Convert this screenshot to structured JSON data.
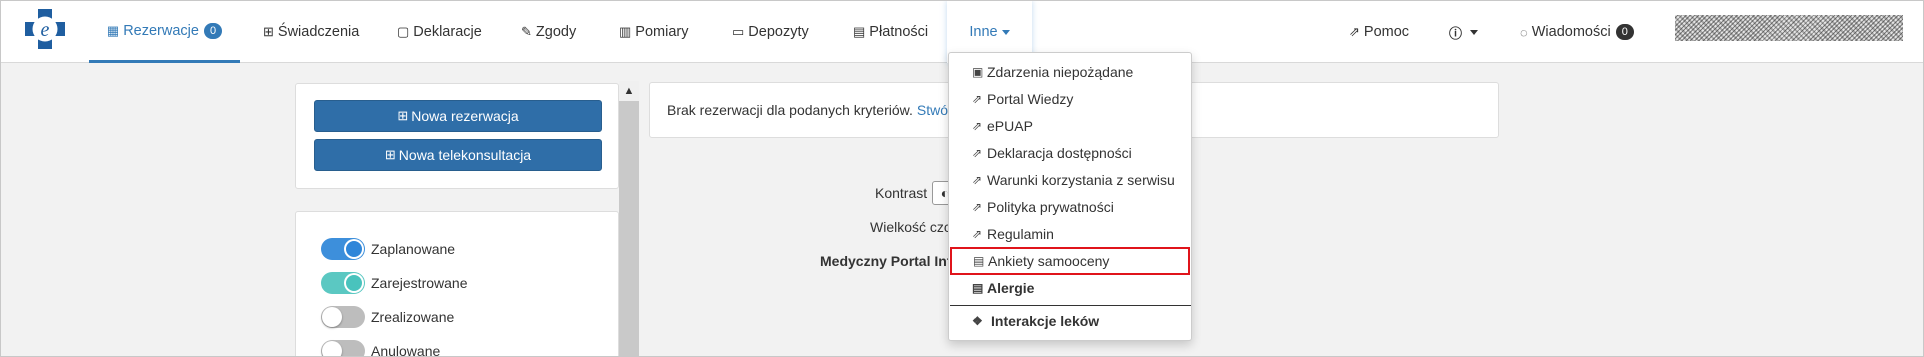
{
  "nav": {
    "items": [
      {
        "label": "Rezerwacje",
        "icon": "calendar-icon",
        "badge": "0"
      },
      {
        "label": "Świadczenia",
        "icon": "medkit-icon"
      },
      {
        "label": "Deklaracje",
        "icon": "file-icon"
      },
      {
        "label": "Zgody",
        "icon": "edit-icon"
      },
      {
        "label": "Pomiary",
        "icon": "bar-chart-icon"
      },
      {
        "label": "Depozyty",
        "icon": "folder-icon"
      },
      {
        "label": "Płatności",
        "icon": "credit-card-icon"
      },
      {
        "label": "Inne"
      }
    ],
    "right": {
      "help_label": "Pomoc",
      "messages_label": "Wiadomości",
      "messages_badge": "0"
    }
  },
  "left_panel": {
    "new_reservation": "Nowa rezerwacja",
    "new_teleconsultation": "Nowa telekonsultacja",
    "filters": [
      {
        "label": "Zaplanowane",
        "on": true,
        "color": "#3d8fdb"
      },
      {
        "label": "Zarejestrowane",
        "on": true,
        "color": "#5bc8c2"
      },
      {
        "label": "Zrealizowane",
        "on": false,
        "color": "#bdbdbd"
      },
      {
        "label": "Anulowane",
        "on": false,
        "color": "#bdbdbd"
      }
    ]
  },
  "main": {
    "info_text": "Brak rezerwacji dla podanych kryteriów.",
    "info_link": "Stwórz",
    "contrast_label": "Kontrast",
    "font_size_label": "Wielkość czci",
    "portal_label": "Medyczny Portal Info"
  },
  "dropdown": {
    "items": [
      {
        "label": "Zdarzenia niepożądane",
        "icon": "clipboard-icon"
      },
      {
        "label": "Portal Wiedzy",
        "icon": "external-link-icon"
      },
      {
        "label": "ePUAP",
        "icon": "external-link-icon"
      },
      {
        "label": "Deklaracja dostępności",
        "icon": "external-link-icon"
      },
      {
        "label": "Warunki korzystania z serwisu",
        "icon": "external-link-icon"
      },
      {
        "label": "Polityka prywatności",
        "icon": "external-link-icon"
      },
      {
        "label": "Regulamin",
        "icon": "external-link-icon"
      },
      {
        "label": "Ankiety samooceny",
        "icon": "document-icon"
      },
      {
        "label": "Alergie",
        "icon": "document-icon"
      },
      {
        "label": "Interakcje leków",
        "icon": "pills-icon"
      }
    ]
  },
  "colors": {
    "accent": "#337ab7",
    "highlight": "#e0141b"
  }
}
